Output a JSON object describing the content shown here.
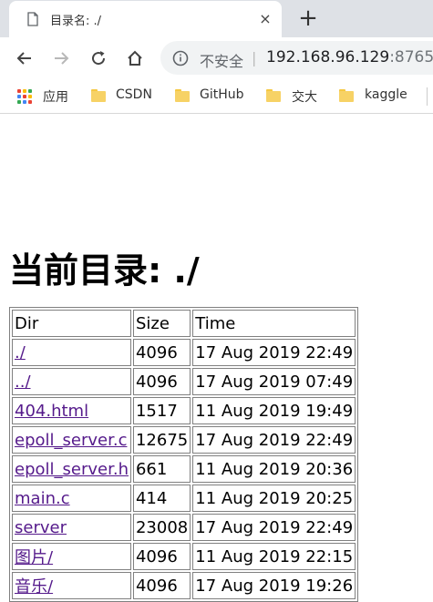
{
  "tab": {
    "title": "目录名: ./",
    "close": "×",
    "new_tab": "+"
  },
  "toolbar": {
    "insecure_label": "不安全",
    "separator": "|",
    "url_host": "192.168.96.129",
    "url_port": ":8765"
  },
  "bookmarks": [
    {
      "label": "应用",
      "icon": "apps-grid-icon"
    },
    {
      "label": "CSDN",
      "icon": "folder-icon"
    },
    {
      "label": "GitHub",
      "icon": "folder-icon"
    },
    {
      "label": "交大",
      "icon": "folder-icon"
    },
    {
      "label": "kaggle",
      "icon": "folder-icon"
    }
  ],
  "page": {
    "heading": "当前目录: ./",
    "columns": [
      "Dir",
      "Size",
      "Time"
    ],
    "rows": [
      {
        "name": "./",
        "size": "4096",
        "time": "17 Aug 2019 22:49"
      },
      {
        "name": "../",
        "size": "4096",
        "time": "17 Aug 2019 07:49"
      },
      {
        "name": "404.html",
        "size": "1517",
        "time": "11 Aug 2019 19:49"
      },
      {
        "name": "epoll_server.c",
        "size": "12675",
        "time": "17 Aug 2019 22:49"
      },
      {
        "name": "epoll_server.h",
        "size": "661",
        "time": "11 Aug 2019 20:36"
      },
      {
        "name": "main.c",
        "size": "414",
        "time": "11 Aug 2019 20:25"
      },
      {
        "name": "server",
        "size": "23008",
        "time": "17 Aug 2019 22:49"
      },
      {
        "name": "图片/",
        "size": "4096",
        "time": "11 Aug 2019 22:15"
      },
      {
        "name": "音乐/",
        "size": "4096",
        "time": "17 Aug 2019 19:26"
      }
    ]
  },
  "colors": {
    "tabstrip_bg": "#dee1e6",
    "omnibox_bg": "#f1f3f4",
    "link_visited": "#551a8b",
    "folder_yellow": "#f7d265"
  }
}
